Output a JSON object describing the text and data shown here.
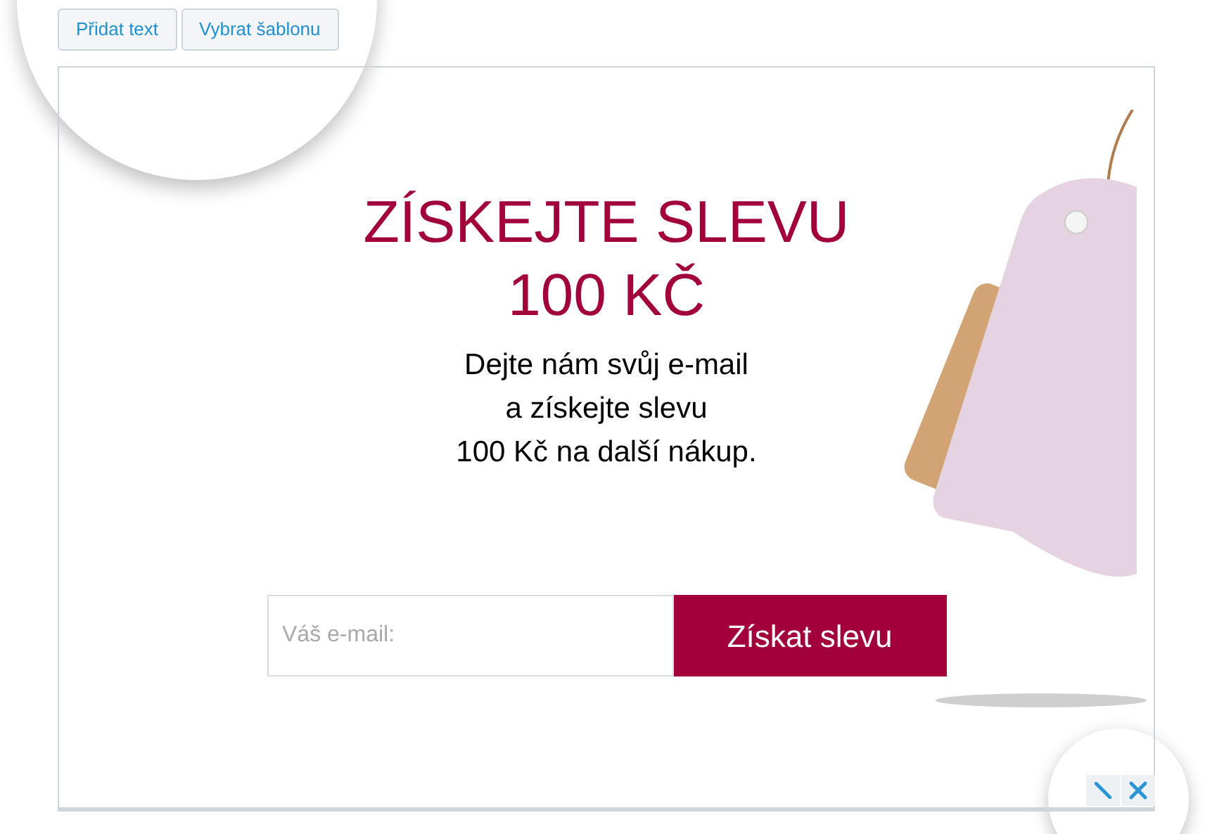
{
  "toolbar": {
    "buttons": [
      "Přidat text",
      "Vybrat šablonu"
    ]
  },
  "popup": {
    "heading": [
      "ZÍSKEJTE SLEVU",
      "100 KČ"
    ],
    "description": [
      "Dejte nám svůj e-mail",
      "a získejte slevu",
      "100 Kč na další nákup."
    ],
    "email_field": {
      "placeholder": "Váš e-mail:"
    },
    "submit_button": "Získat slevu"
  }
}
